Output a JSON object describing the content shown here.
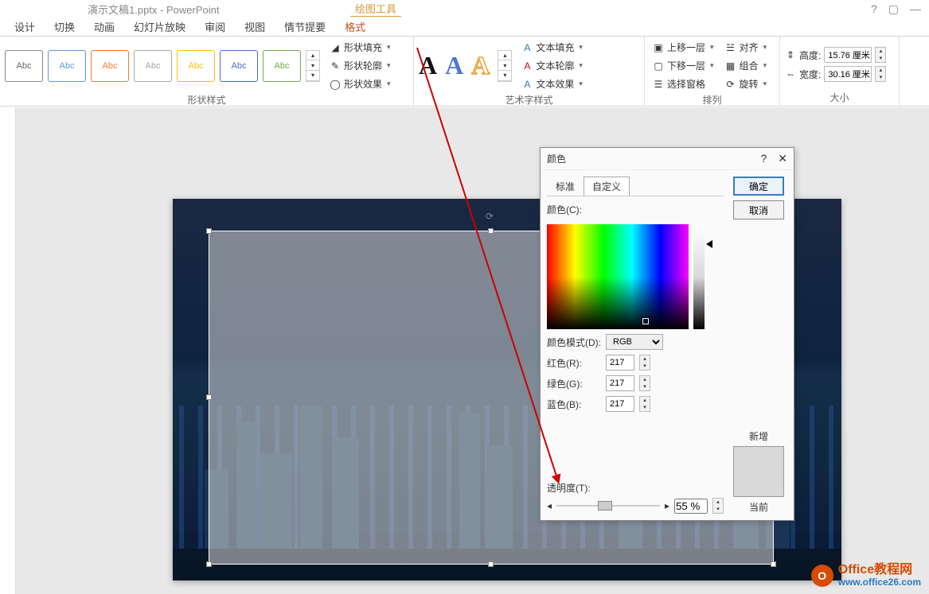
{
  "titlebar": {
    "doc": "演示文稿1.pptx - PowerPoint",
    "tool_tab": "绘图工具",
    "help": "?",
    "restore": "▢",
    "min": "—"
  },
  "tabs": [
    "设计",
    "切换",
    "动画",
    "幻灯片放映",
    "审阅",
    "视图",
    "情节提要",
    "格式"
  ],
  "active_tab": "格式",
  "shape_gallery_label": "Abc",
  "shape_fill": "形状填充",
  "shape_outline": "形状轮廓",
  "shape_effects": "形状效果",
  "group_shape": "形状样式",
  "wordart_label": "A",
  "text_fill": "文本填充",
  "text_outline": "文本轮廓",
  "text_effects": "文本效果",
  "group_wordart": "艺术字样式",
  "bring_forward": "上移一层",
  "send_backward": "下移一层",
  "sel_pane": "选择窗格",
  "align": "对齐",
  "group_btn": "组合",
  "rotate": "旋转",
  "group_arrange": "排列",
  "height_label": "高度:",
  "width_label": "宽度:",
  "height_val": "15.76 厘米",
  "width_val": "30.16 厘米",
  "group_size": "大小",
  "dialog": {
    "title": "颜色",
    "help": "?",
    "close": "✕",
    "tab_std": "标准",
    "tab_custom": "自定义",
    "color_label": "颜色(C):",
    "mode_label": "颜色模式(D):",
    "mode_val": "RGB",
    "red_label": "红色(R):",
    "green_label": "绿色(G):",
    "blue_label": "蓝色(B):",
    "red": "217",
    "green": "217",
    "blue": "217",
    "trans_label": "透明度(T):",
    "trans_val": "55 %",
    "ok": "确定",
    "cancel": "取消",
    "new": "新增",
    "current": "当前"
  },
  "watermark": {
    "brand": "Office教程网",
    "url": "www.office26.com"
  }
}
